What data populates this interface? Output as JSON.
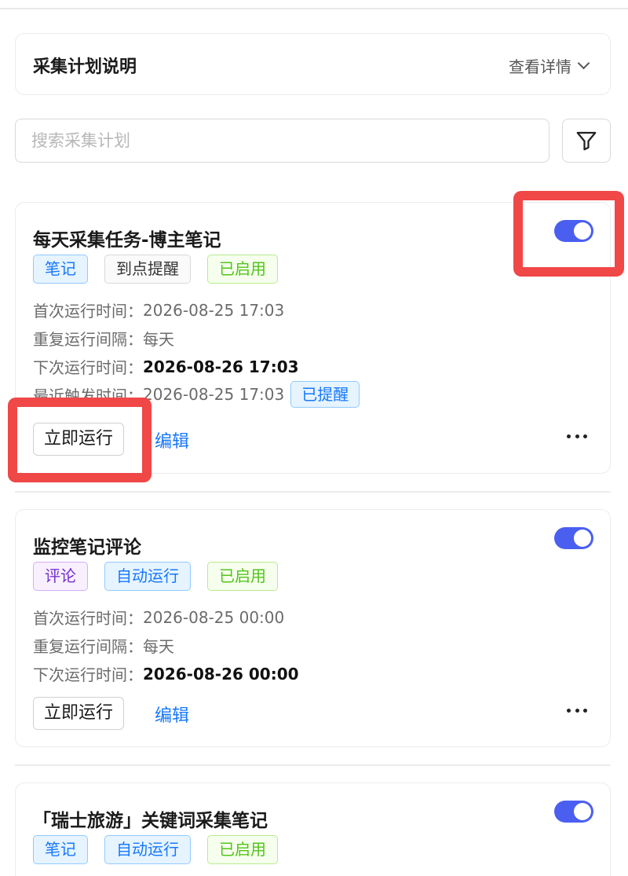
{
  "plan_info": {
    "title": "采集计划说明",
    "detail_label": "查看详情"
  },
  "search": {
    "placeholder": "搜索采集计划",
    "value": ""
  },
  "icons": {
    "filter": "filter-icon",
    "more": "more-dots-icon",
    "chevron": "chevron-down-icon"
  },
  "colors": {
    "accent": "#4a5ff0",
    "link": "#1677ff",
    "highlight": "#f04747"
  },
  "plans": [
    {
      "title": "每天采集任务-博主笔记",
      "enabled": true,
      "tags": [
        {
          "label": "笔记",
          "style": "blue"
        },
        {
          "label": "到点提醒",
          "style": "gray"
        },
        {
          "label": "已启用",
          "style": "green"
        }
      ],
      "fields": [
        {
          "label": "首次运行时间：",
          "value": "2026-08-25 17:03"
        },
        {
          "label": "重复运行间隔：",
          "value": "每天"
        },
        {
          "label": "下次运行时间：",
          "value": "2026-08-26 17:03"
        },
        {
          "label": "最近触发时间：",
          "value": "2026-08-25 17:03",
          "badge": "已提醒"
        }
      ],
      "run_label": "立即运行",
      "edit_label": "编辑"
    },
    {
      "title": "监控笔记评论",
      "enabled": true,
      "tags": [
        {
          "label": "评论",
          "style": "purple"
        },
        {
          "label": "自动运行",
          "style": "blue"
        },
        {
          "label": "已启用",
          "style": "green"
        }
      ],
      "fields": [
        {
          "label": "首次运行时间：",
          "value": "2026-08-25 00:00"
        },
        {
          "label": "重复运行间隔：",
          "value": "每天"
        },
        {
          "label": "下次运行时间：",
          "value": "2026-08-26 00:00"
        }
      ],
      "run_label": "立即运行",
      "edit_label": "编辑"
    },
    {
      "title": "「瑞士旅游」关键词采集笔记",
      "enabled": true,
      "tags": [
        {
          "label": "笔记",
          "style": "blue"
        },
        {
          "label": "自动运行",
          "style": "blue"
        },
        {
          "label": "已启用",
          "style": "green"
        }
      ]
    }
  ]
}
